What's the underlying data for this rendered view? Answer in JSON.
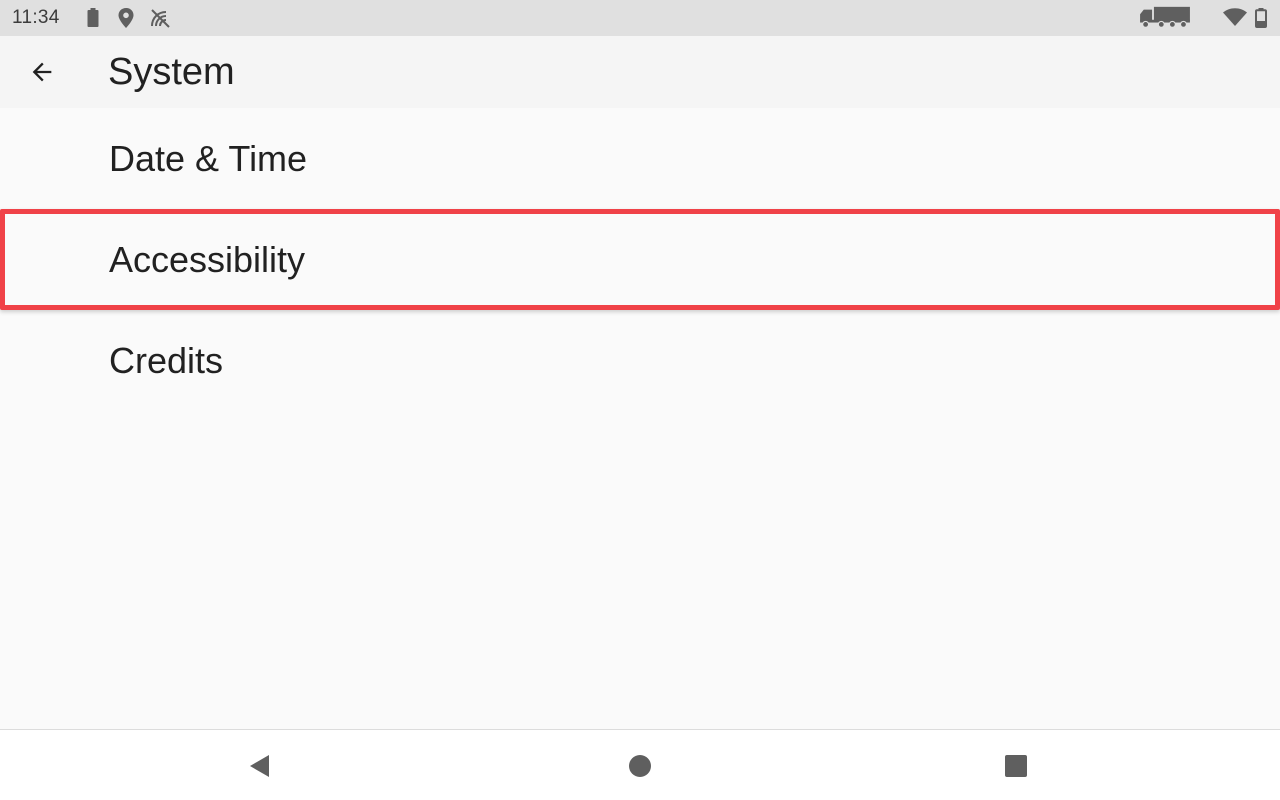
{
  "status_bar": {
    "time": "11:34",
    "left_icons": [
      "battery-icon",
      "location-pin-icon",
      "no-satellite-icon"
    ],
    "right_icons": [
      "truck-icon",
      "wifi-icon",
      "battery-icon"
    ]
  },
  "app_bar": {
    "back_icon": "arrow-left-icon",
    "title": "System"
  },
  "list": {
    "items": [
      {
        "label": "Date & Time"
      },
      {
        "label": "Accessibility",
        "highlighted": true
      },
      {
        "label": "Credits"
      }
    ]
  },
  "nav_bar": {
    "icons": [
      "back-triangle-icon",
      "home-circle-icon",
      "recents-square-icon"
    ]
  },
  "colors": {
    "status_bar_bg": "#e0e0e0",
    "app_bar_bg": "#f5f5f5",
    "screen_bg": "#fafafa",
    "text_primary": "#212121",
    "highlight_border": "#f04248",
    "icon_gray": "#5f5f5f"
  }
}
